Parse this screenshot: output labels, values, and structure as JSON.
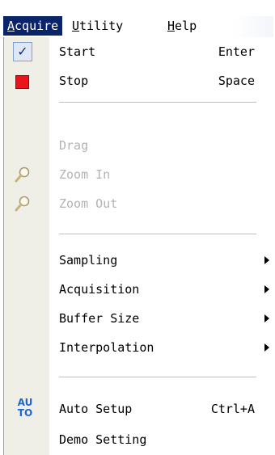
{
  "menubar": {
    "items": [
      {
        "label": "Acquire",
        "mnemonic": "A"
      },
      {
        "label": "Utility",
        "mnemonic": "U"
      },
      {
        "label": "Help",
        "mnemonic": "H"
      }
    ]
  },
  "menu": {
    "items": [
      {
        "label": "Start",
        "shortcut": "Enter",
        "icon": "check-icon",
        "enabled": true
      },
      {
        "label": "Stop",
        "shortcut": "Space",
        "icon": "stop-icon",
        "enabled": true
      },
      {
        "label": "Drag",
        "enabled": false
      },
      {
        "label": "Zoom In",
        "icon": "magnifier-icon",
        "enabled": false
      },
      {
        "label": "Zoom Out",
        "icon": "magnifier-icon",
        "enabled": false
      },
      {
        "label": "Sampling",
        "submenu": true,
        "enabled": true
      },
      {
        "label": "Acquisition",
        "submenu": true,
        "enabled": true
      },
      {
        "label": "Buffer Size",
        "submenu": true,
        "enabled": true
      },
      {
        "label": "Interpolation",
        "submenu": true,
        "enabled": true
      },
      {
        "label": "Auto Setup",
        "shortcut": "Ctrl+A",
        "icon": "auto-icon",
        "icon_text": "AU\nTO",
        "enabled": true
      },
      {
        "label": "Demo Setting",
        "enabled": true
      }
    ]
  },
  "colors": {
    "menubar_highlight": "#0a246a",
    "gutter": "#f0efe7",
    "disabled_text": "#b3b3b3",
    "stop_red": "#e8161b",
    "auto_blue": "#1a67d6"
  }
}
